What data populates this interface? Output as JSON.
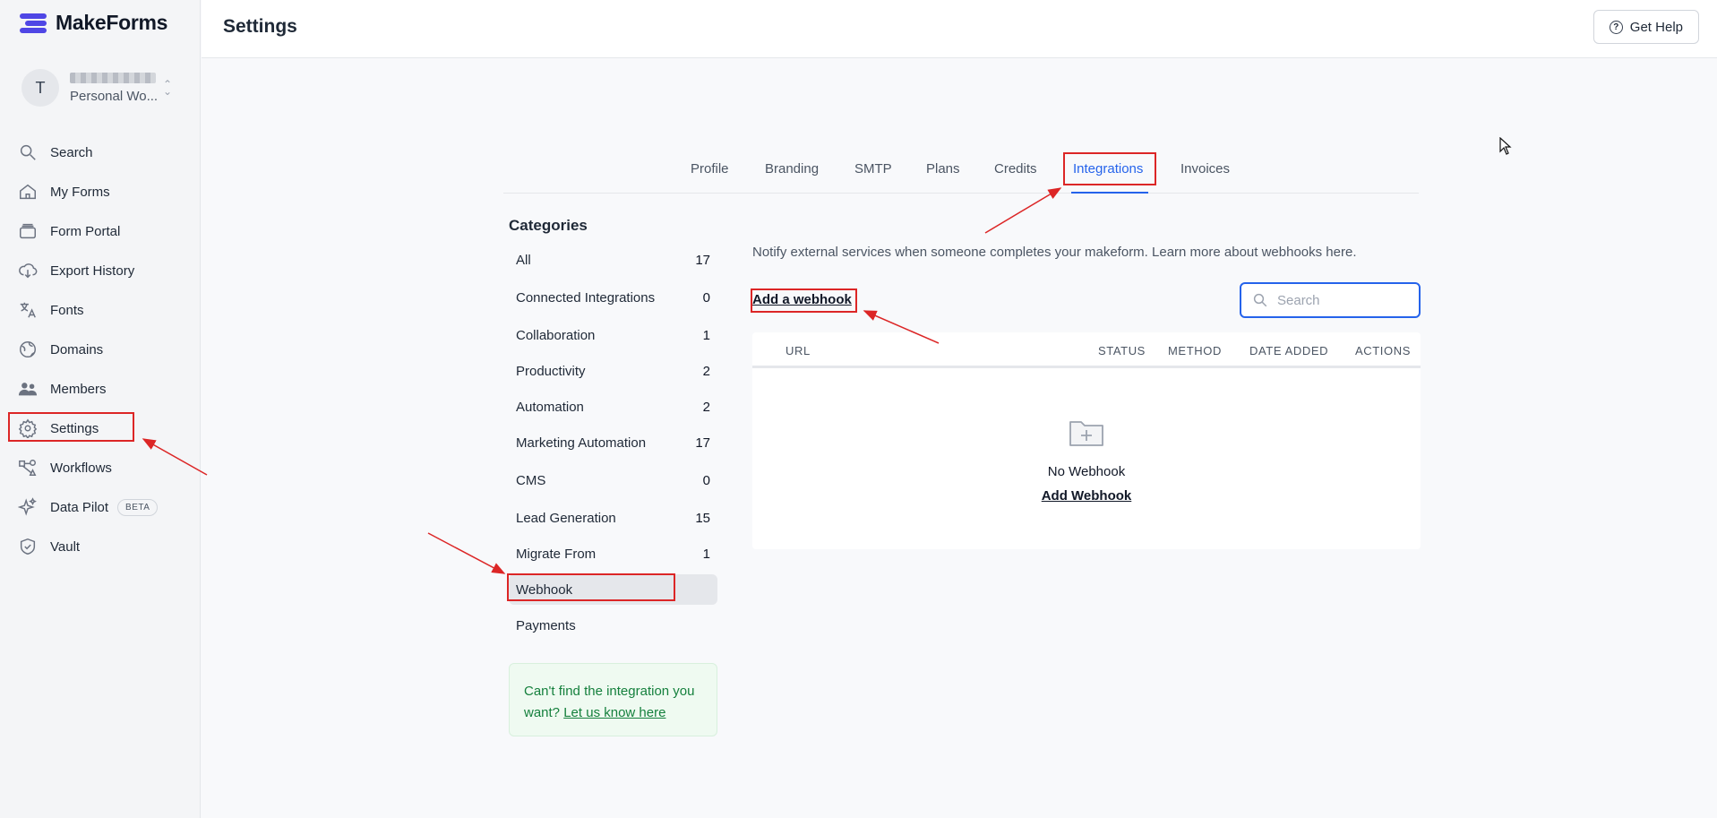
{
  "app": {
    "brand_name": "MakeForms",
    "accent_color": "#2563eb",
    "brand_color": "#4f46e5"
  },
  "workspace": {
    "avatar_letter": "T",
    "subtitle": "Personal Wo..."
  },
  "nav": {
    "items": [
      {
        "label": "Search",
        "icon": "search-icon"
      },
      {
        "label": "My Forms",
        "icon": "home-icon"
      },
      {
        "label": "Form Portal",
        "icon": "portal-icon"
      },
      {
        "label": "Export History",
        "icon": "cloud-download-icon"
      },
      {
        "label": "Fonts",
        "icon": "translate-icon"
      },
      {
        "label": "Domains",
        "icon": "globe-icon"
      },
      {
        "label": "Members",
        "icon": "users-icon"
      },
      {
        "label": "Settings",
        "icon": "gear-icon"
      },
      {
        "label": "Workflows",
        "icon": "workflow-icon"
      },
      {
        "label": "Data Pilot",
        "icon": "sparkle-icon",
        "badge": "BETA"
      },
      {
        "label": "Vault",
        "icon": "shield-icon"
      }
    ]
  },
  "header": {
    "title": "Settings",
    "help_label": "Get Help"
  },
  "tabs": [
    "Profile",
    "Branding",
    "SMTP",
    "Plans",
    "Credits",
    "Integrations",
    "Invoices"
  ],
  "active_tab": "Integrations",
  "categories": {
    "title": "Categories",
    "items": [
      {
        "label": "All",
        "count": "17"
      },
      {
        "label": "Connected Integrations",
        "count": "0"
      },
      {
        "label": "Collaboration",
        "count": "1"
      },
      {
        "label": "Productivity",
        "count": "2"
      },
      {
        "label": "Automation",
        "count": "2"
      },
      {
        "label": "Marketing Automation",
        "count": "17"
      },
      {
        "label": "CMS",
        "count": "0"
      },
      {
        "label": "Lead Generation",
        "count": "15"
      },
      {
        "label": "Migrate From",
        "count": "1"
      },
      {
        "label": "Webhook",
        "count": ""
      },
      {
        "label": "Payments",
        "count": ""
      }
    ],
    "active": "Webhook"
  },
  "help_card": {
    "text": "Can't find the integration you want?",
    "link": "Let us know here"
  },
  "webhooks": {
    "description": "Notify external services when someone completes your makeform. Learn more about webhooks here.",
    "add_link": "Add a webhook",
    "search_placeholder": "Search",
    "columns": [
      "URL",
      "STATUS",
      "METHOD",
      "DATE ADDED",
      "ACTIONS"
    ],
    "empty_title": "No Webhook",
    "empty_link": "Add Webhook"
  }
}
